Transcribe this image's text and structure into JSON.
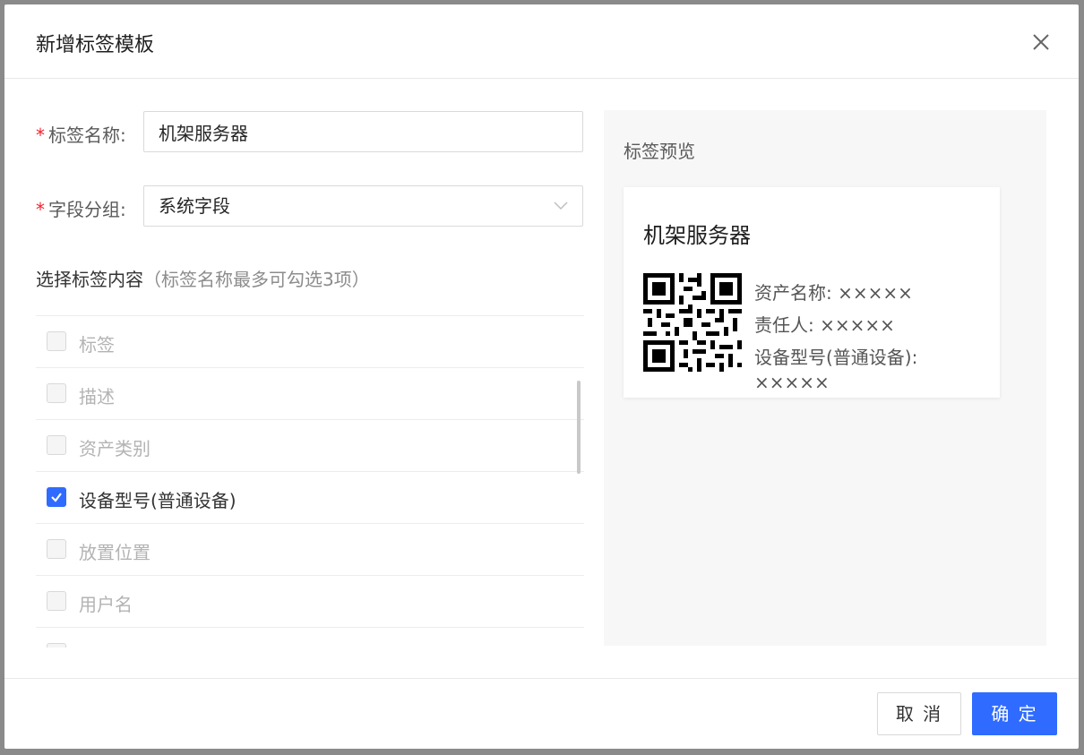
{
  "dialog": {
    "title": "新增标签模板"
  },
  "form": {
    "name_label": "标签名称:",
    "name_value": "机架服务器",
    "group_label": "字段分组:",
    "group_value": "系统字段"
  },
  "content": {
    "title": "选择标签内容",
    "hint": "（标签名称最多可勾选3项）",
    "items": [
      {
        "label": "标签",
        "checked": false
      },
      {
        "label": "描述",
        "checked": false
      },
      {
        "label": "资产类别",
        "checked": false
      },
      {
        "label": "设备型号(普通设备)",
        "checked": true
      },
      {
        "label": "放置位置",
        "checked": false
      },
      {
        "label": "用户名",
        "checked": false
      }
    ]
  },
  "preview": {
    "title": "标签预览",
    "card_title": "机架服务器",
    "fields": [
      "资产名称: ×××××",
      "责任人: ×××××",
      "设备型号(普通设备):",
      "×××××"
    ]
  },
  "footer": {
    "cancel_label": "取 消",
    "ok_label": "确 定"
  },
  "colors": {
    "primary": "#2f6bff",
    "required": "#f5222d"
  },
  "icons": {
    "close": "close-icon",
    "select": "chevron-down-icon",
    "check": "check-icon",
    "qr": "qr-code-icon"
  }
}
